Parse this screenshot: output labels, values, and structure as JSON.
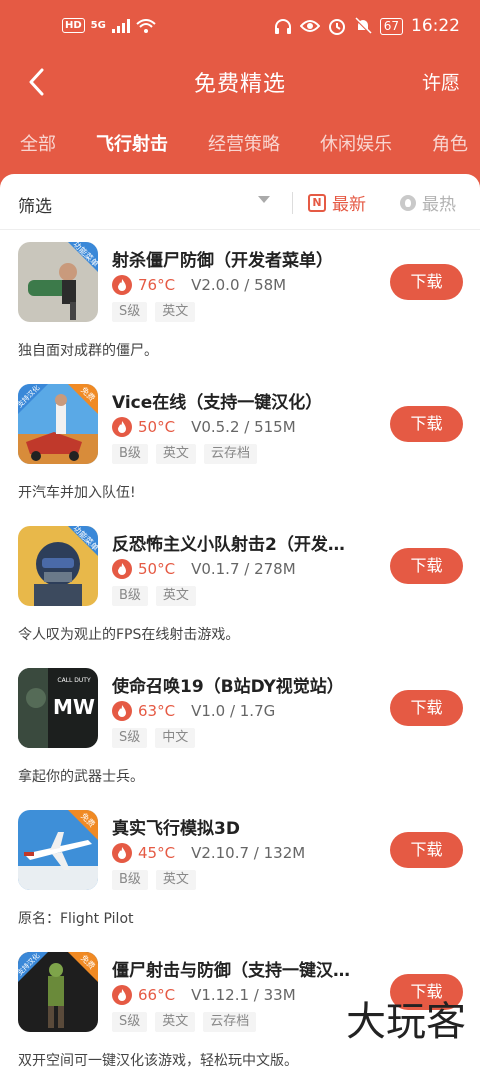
{
  "status_bar": {
    "left_icons": [
      "HD",
      "5G",
      "signal-icon",
      "wifi-icon"
    ],
    "right_icons": [
      "headphones-icon",
      "eye-icon",
      "alarm-icon",
      "mute-icon"
    ],
    "battery": "67",
    "time": "16:22"
  },
  "header": {
    "title": "免费精选",
    "wish_label": "许愿"
  },
  "tabs": [
    "全部",
    "飞行射击",
    "经营策略",
    "休闲娱乐",
    "角色"
  ],
  "active_tab": 1,
  "filter": {
    "label": "筛选",
    "sort_new": "最新",
    "sort_hot": "最热"
  },
  "games": [
    {
      "name": "射杀僵尸防御（开发者菜单）",
      "temp": "76°C",
      "version": "V2.0.0 / 58M",
      "tags": [
        "S级",
        "英文"
      ],
      "button": "下载",
      "desc": "独自面对成群的僵尸。",
      "badge": "功能菜单"
    },
    {
      "name": "Vice在线（支持一键汉化）",
      "temp": "50°C",
      "version": "V0.5.2 / 515M",
      "tags": [
        "B级",
        "英文",
        "云存档"
      ],
      "button": "下载",
      "desc": "开汽车并加入队伍!",
      "badge": "支持汉化",
      "badge2": "免费"
    },
    {
      "name": "反恐怖主义小队射击2（开发…",
      "temp": "50°C",
      "version": "V0.1.7 / 278M",
      "tags": [
        "B级",
        "英文"
      ],
      "button": "下载",
      "desc": "令人叹为观止的FPS在线射击游戏。",
      "badge": "功能菜单"
    },
    {
      "name": "使命召唤19（B站DY视觉站）",
      "temp": "63°C",
      "version": "V1.0 / 1.7G",
      "tags": [
        "S级",
        "中文"
      ],
      "button": "下载",
      "desc": "拿起你的武器士兵。",
      "icon_text": "CALL DUTY",
      "icon_text2": "MW"
    },
    {
      "name": "真实飞行模拟3D",
      "temp": "45°C",
      "version": "V2.10.7 / 132M",
      "tags": [
        "B级",
        "英文"
      ],
      "button": "下载",
      "desc": "原名：Flight Pilot",
      "badge": "免费"
    },
    {
      "name": "僵尸射击与防御（支持一键汉…",
      "temp": "66°C",
      "version": "V1.12.1 / 33M",
      "tags": [
        "S级",
        "英文",
        "云存档"
      ],
      "button": "下载",
      "desc": "双开空间可一键汉化该游戏，轻松玩中文版。",
      "badge": "支持汉化",
      "badge2": "免费"
    }
  ],
  "watermark": "大玩客",
  "colors": {
    "brand": "#e55a44",
    "panel": "#ffffff"
  }
}
